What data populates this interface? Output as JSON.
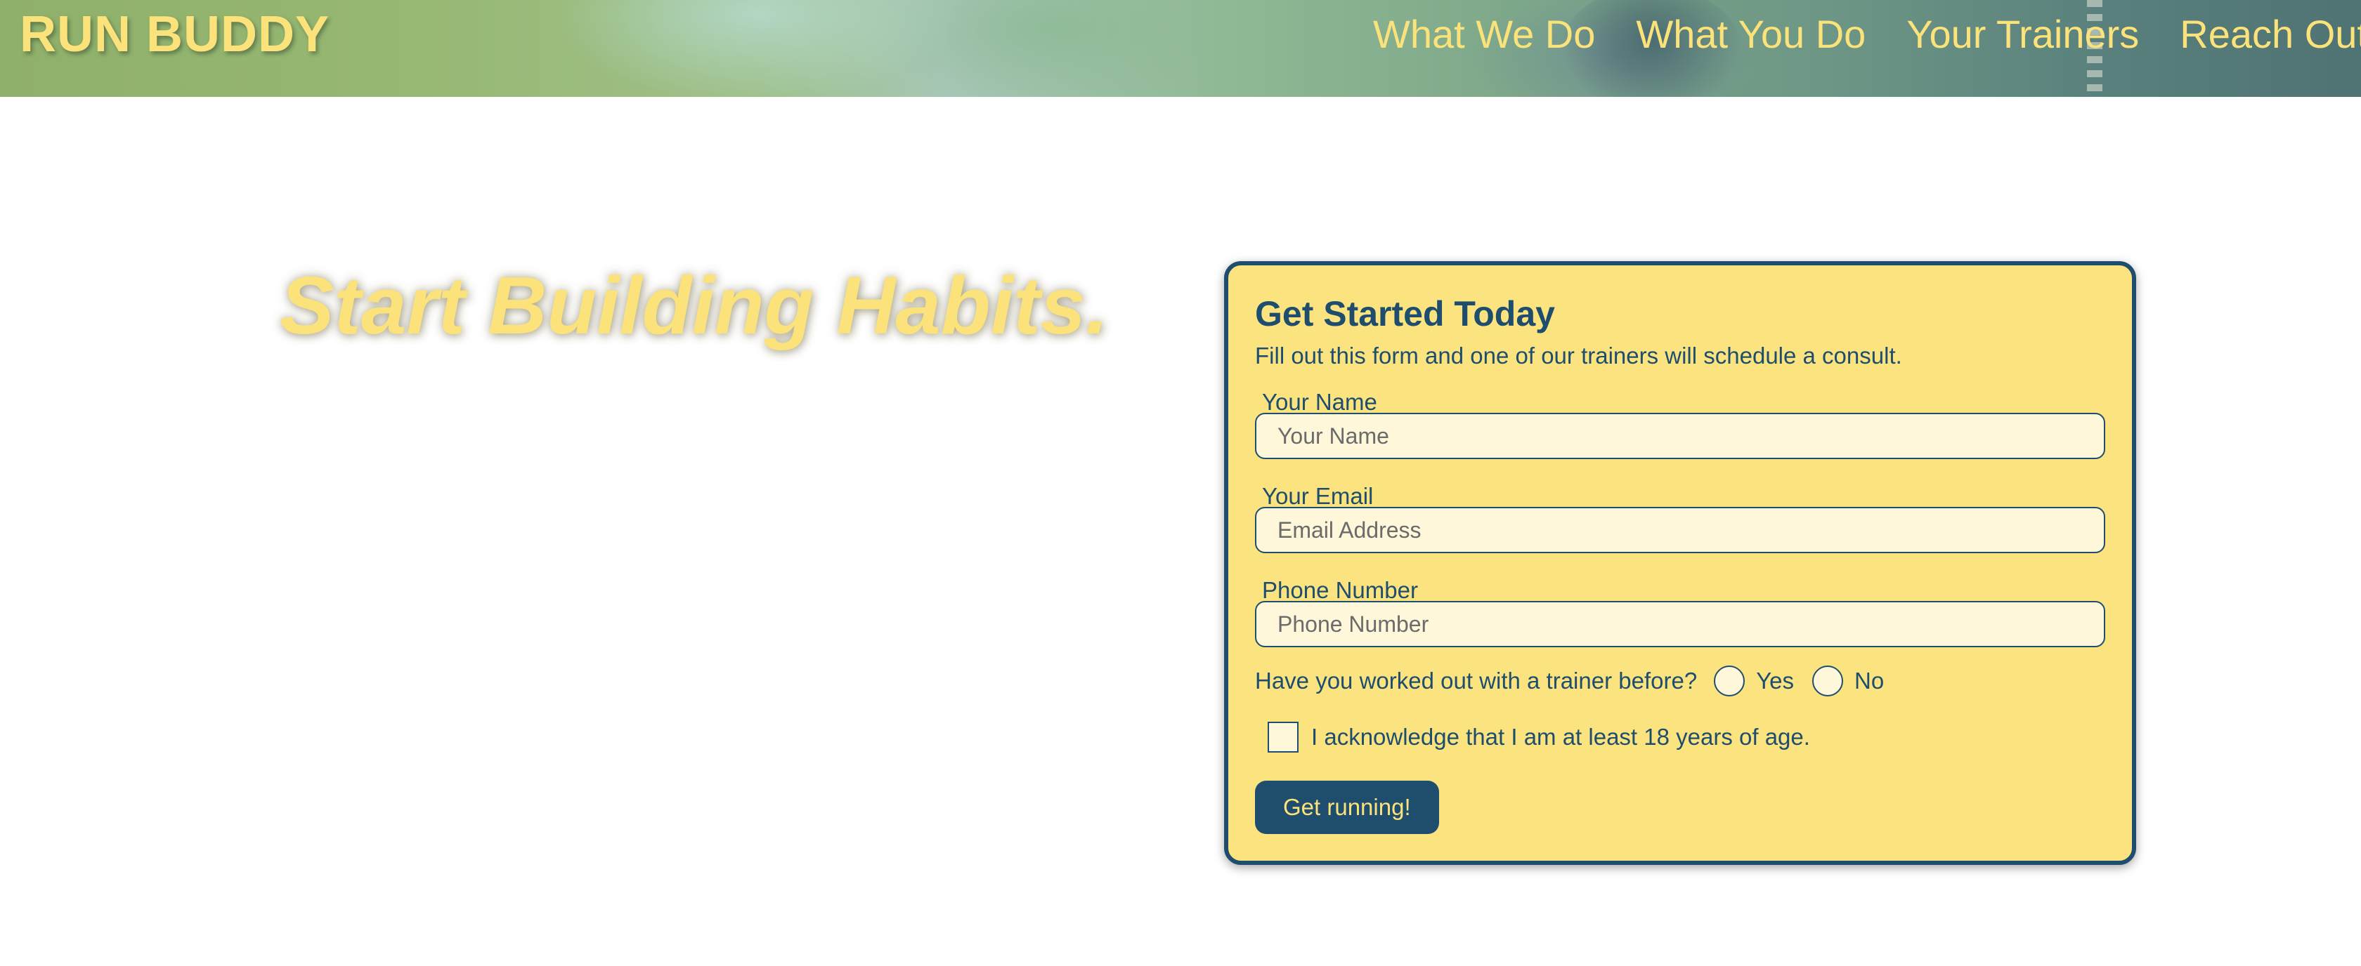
{
  "header": {
    "brand": "RUN BUDDY",
    "nav": [
      {
        "label": "What We Do"
      },
      {
        "label": "What You Do"
      },
      {
        "label": "Your Trainers"
      },
      {
        "label": "Reach Out"
      }
    ]
  },
  "hero": {
    "headline": "Start Building Habits."
  },
  "form": {
    "title": "Get Started Today",
    "subtitle": "Fill out this form and one of our trainers will schedule a consult.",
    "name": {
      "label": "Your Name",
      "placeholder": "Your Name"
    },
    "email": {
      "label": "Your Email",
      "placeholder": "Email Address"
    },
    "phone": {
      "label": "Phone Number",
      "placeholder": "Phone Number"
    },
    "trainer_question": "Have you worked out with a trainer before?",
    "options": {
      "yes": "Yes",
      "no": "No"
    },
    "acknowledge": "I acknowledge that I am at least 18 years of age.",
    "submit_label": "Get running!"
  },
  "colors": {
    "accent_yellow": "#fbe27a",
    "navy": "#1f4d6e",
    "card_bg": "#fbe47f",
    "input_bg": "#fef7d9"
  }
}
